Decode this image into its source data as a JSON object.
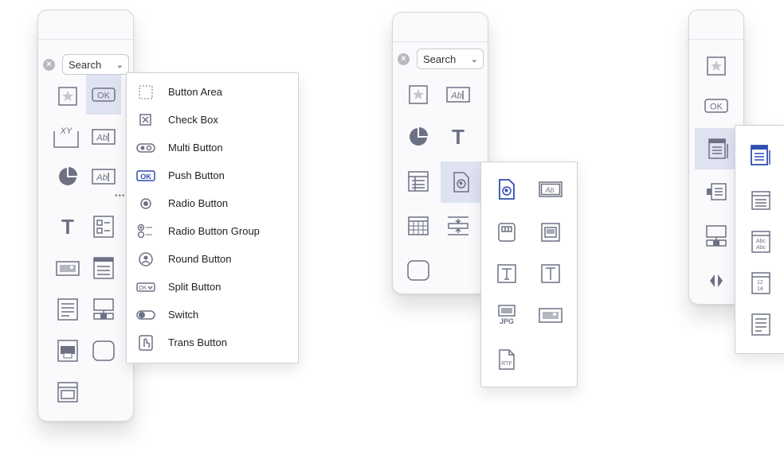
{
  "colors": {
    "icon": "#6d7183",
    "accent": "#2f4fb0",
    "selected_bg": "#dfe3f1"
  },
  "panel1": {
    "search": {
      "value": "Search"
    },
    "tools": [
      "star-icon",
      "push-button-icon",
      "xy-icon",
      "text-field-icon",
      "pie-chart-icon",
      "text-field-icon",
      "text-icon",
      "checklist-icon",
      "image-icon",
      "list-icon",
      "form-icon",
      "layout-icon",
      "print-icon",
      "round-rect-icon",
      "window-icon"
    ],
    "menu": [
      {
        "label": "Button Area",
        "icon": "button-area-icon"
      },
      {
        "label": "Check Box",
        "icon": "check-box-icon"
      },
      {
        "label": "Multi Button",
        "icon": "multi-button-icon"
      },
      {
        "label": "Push Button",
        "icon": "push-button-icon"
      },
      {
        "label": "Radio Button",
        "icon": "radio-button-icon"
      },
      {
        "label": "Radio Button Group",
        "icon": "radio-group-icon"
      },
      {
        "label": "Round Button",
        "icon": "round-button-icon"
      },
      {
        "label": "Split Button",
        "icon": "split-button-icon"
      },
      {
        "label": "Switch",
        "icon": "switch-icon"
      },
      {
        "label": "Trans Button",
        "icon": "trans-button-icon"
      }
    ]
  },
  "panel2": {
    "search": {
      "value": "Search"
    },
    "icon_text": {
      "ab": "Ab",
      "jpg": "JPG",
      "rtf": "RTF"
    }
  },
  "panel3": {
    "icon_text": {
      "ok": "OK",
      "abc1": "Abc",
      "abc2": "Abc",
      "n1": "12",
      "n2": "14"
    }
  },
  "panel1_text": {
    "ok": "OK",
    "xy": "XY",
    "ab": "Ab",
    "ab2": "Ab",
    "t": "T",
    "ok_menu": "OK",
    "ok_split": "OK"
  }
}
